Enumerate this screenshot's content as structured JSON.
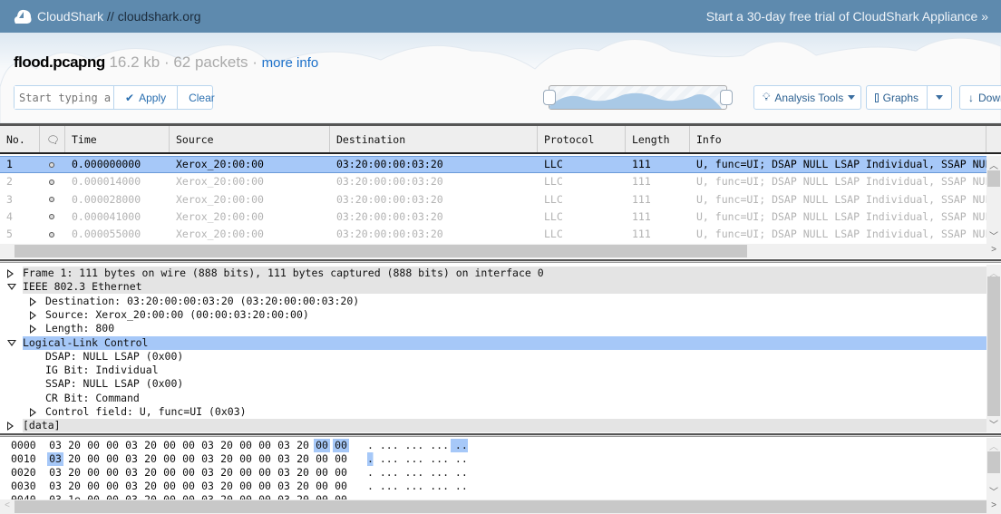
{
  "topbar": {
    "brand": "CloudShark",
    "separator": " // ",
    "domain": "cloudshark.org",
    "trial_link": "Start a 30-day free trial of CloudShark Appliance »"
  },
  "file": {
    "name": "flood.pcapng",
    "size": "16.2 kb",
    "packets": "62 packets",
    "more_info": "more info"
  },
  "filter": {
    "placeholder": "Start typing a",
    "apply_label": "Apply",
    "clear_label": "Clear"
  },
  "toolbar": {
    "analysis_tools": "Analysis Tools",
    "graphs": "Graphs",
    "download": "Download"
  },
  "packet_list": {
    "columns": [
      "No.",
      "",
      "Time",
      "Source",
      "Destination",
      "Protocol",
      "Length",
      "Info"
    ],
    "rows": [
      [
        "1",
        "0.000000000",
        "Xerox_20:00:00",
        "03:20:00:00:03:20",
        "LLC",
        "111",
        "U, func=UI; DSAP NULL LSAP Individual, SSAP NULL LSAP Command"
      ],
      [
        "2",
        "0.000014000",
        "Xerox_20:00:00",
        "03:20:00:00:03:20",
        "LLC",
        "111",
        "U, func=UI; DSAP NULL LSAP Individual, SSAP NULL LSAP Command"
      ],
      [
        "3",
        "0.000028000",
        "Xerox_20:00:00",
        "03:20:00:00:03:20",
        "LLC",
        "111",
        "U, func=UI; DSAP NULL LSAP Individual, SSAP NULL LSAP Command"
      ],
      [
        "4",
        "0.000041000",
        "Xerox_20:00:00",
        "03:20:00:00:03:20",
        "LLC",
        "111",
        "U, func=UI; DSAP NULL LSAP Individual, SSAP NULL LSAP Command"
      ],
      [
        "5",
        "0.000055000",
        "Xerox_20:00:00",
        "03:20:00:00:03:20",
        "LLC",
        "111",
        "U, func=UI; DSAP NULL LSAP Individual, SSAP NULL LSAP Command"
      ]
    ],
    "selected_row": 0
  },
  "detail_tree": [
    {
      "level": 0,
      "expander": "collapsed",
      "style": "gray",
      "text": "Frame 1: 111 bytes on wire (888 bits), 111 bytes captured (888 bits) on interface 0"
    },
    {
      "level": 0,
      "expander": "expanded",
      "style": "gray",
      "text": "IEEE 802.3 Ethernet"
    },
    {
      "level": 1,
      "expander": "collapsed",
      "style": "",
      "text": "Destination: 03:20:00:00:03:20 (03:20:00:00:03:20)"
    },
    {
      "level": 1,
      "expander": "collapsed",
      "style": "",
      "text": "Source: Xerox_20:00:00 (00:00:03:20:00:00)"
    },
    {
      "level": 1,
      "expander": "collapsed",
      "style": "",
      "text": "Length: 800"
    },
    {
      "level": 0,
      "expander": "expanded",
      "style": "blue",
      "text": "Logical-Link Control"
    },
    {
      "level": 1,
      "expander": "none",
      "style": "",
      "text": "DSAP: NULL LSAP (0x00)"
    },
    {
      "level": 1,
      "expander": "none",
      "style": "",
      "text": "IG Bit: Individual"
    },
    {
      "level": 1,
      "expander": "none",
      "style": "",
      "text": "SSAP: NULL LSAP (0x00)"
    },
    {
      "level": 1,
      "expander": "none",
      "style": "",
      "text": "CR Bit: Command"
    },
    {
      "level": 1,
      "expander": "collapsed",
      "style": "",
      "text": "Control field: U, func=UI (0x03)"
    },
    {
      "level": 0,
      "expander": "collapsed",
      "style": "gray",
      "text": "[data]"
    }
  ],
  "hex_dump": [
    {
      "offset": "0000",
      "bytes": [
        "03",
        "20",
        "00",
        "00",
        "03",
        "20",
        "00",
        "00",
        "03",
        "20",
        "00",
        "00",
        "03",
        "20",
        "00",
        "00"
      ],
      "ascii": ". ... ... ... ..",
      "highlight": [
        14,
        15
      ]
    },
    {
      "offset": "0010",
      "bytes": [
        "03",
        "20",
        "00",
        "00",
        "03",
        "20",
        "00",
        "00",
        "03",
        "20",
        "00",
        "00",
        "03",
        "20",
        "00",
        "00"
      ],
      "ascii": ". ... ... ... ..",
      "highlight": [
        0
      ]
    },
    {
      "offset": "0020",
      "bytes": [
        "03",
        "20",
        "00",
        "00",
        "03",
        "20",
        "00",
        "00",
        "03",
        "20",
        "00",
        "00",
        "03",
        "20",
        "00",
        "00"
      ],
      "ascii": ". ... ... ... ..",
      "highlight": []
    },
    {
      "offset": "0030",
      "bytes": [
        "03",
        "20",
        "00",
        "00",
        "03",
        "20",
        "00",
        "00",
        "03",
        "20",
        "00",
        "00",
        "03",
        "20",
        "00",
        "00"
      ],
      "ascii": ". ... ... ... ..",
      "highlight": []
    },
    {
      "offset": "0040",
      "bytes": [
        "03",
        "1e",
        "00",
        "00",
        "03",
        "20",
        "00",
        "00",
        "03",
        "20",
        "00",
        "00",
        "03",
        "20",
        "00",
        "00"
      ],
      "ascii": "",
      "highlight": []
    }
  ],
  "colors": {
    "topbar": "#5e8aae",
    "selection": "#a6c8f8",
    "link": "#1a6fc9"
  }
}
